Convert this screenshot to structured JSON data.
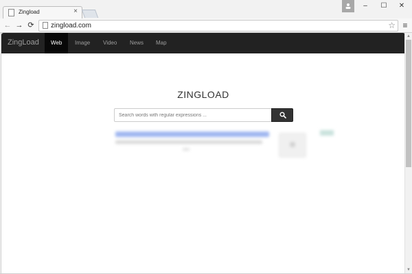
{
  "browser": {
    "tab_title": "Zingload",
    "tab_close": "×",
    "url": "zingload.com",
    "window_controls": {
      "minimize": "–",
      "maximize": "☐",
      "close": "✕"
    },
    "nav": {
      "back": "←",
      "forward": "→",
      "reload": "⟳",
      "star": "☆",
      "menu": "≡"
    }
  },
  "site": {
    "brand": "ZingLoad",
    "nav_items": [
      {
        "label": "Web",
        "active": true
      },
      {
        "label": "Image",
        "active": false
      },
      {
        "label": "Video",
        "active": false
      },
      {
        "label": "News",
        "active": false
      },
      {
        "label": "Map",
        "active": false
      }
    ],
    "title": "ZINGLOAD",
    "search": {
      "placeholder": "Search words with regular expressions ...",
      "value": ""
    }
  },
  "icons": {
    "tab": "page-icon",
    "url": "page-icon",
    "search": "search-icon",
    "star": "star-icon",
    "menu": "hamburger-icon",
    "user": "user-icon"
  },
  "colors": {
    "navbar_bg": "#222222",
    "navbar_active_bg": "#080808",
    "nav_text": "#9d9d9d",
    "search_button": "#333333",
    "title_text": "#333333"
  }
}
